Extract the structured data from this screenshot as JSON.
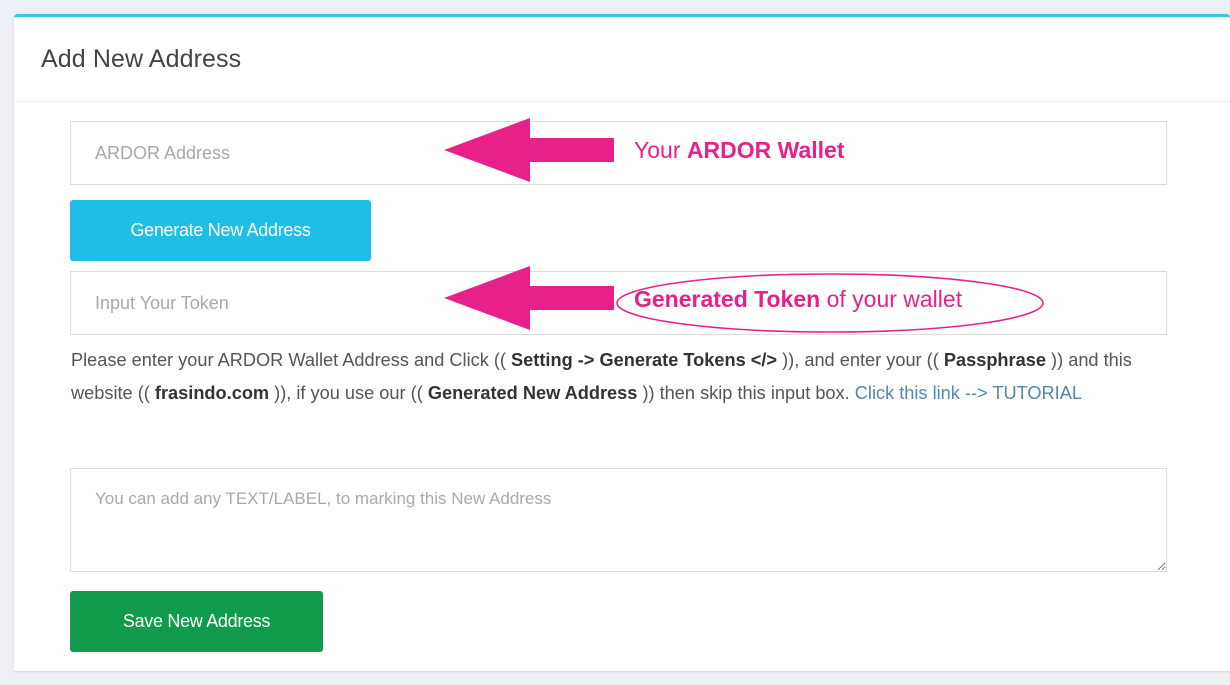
{
  "card": {
    "title": "Add New Address"
  },
  "form": {
    "address_placeholder": "ARDOR Address",
    "generate_label": "Generate New Address",
    "token_placeholder": "Input Your Token",
    "label_placeholder": "You can add any TEXT/LABEL, to marking this New Address",
    "save_label": "Save New Address"
  },
  "help": {
    "p1": "Please enter your ARDOR Wallet Address and Click ((",
    "b1": "Setting -> Generate Tokens </>",
    "p2": ")), and enter your ((",
    "b2": "Passphrase",
    "p3": ")) and this website ((",
    "b3": "frasindo.com",
    "p4": ")), if you use our ((",
    "b4": "Generated New Address",
    "p5": ")) then skip this input box.",
    "link": "Click this link --> TUTORIAL"
  },
  "annotations": {
    "wallet_prefix": "Your",
    "wallet_bold": "ARDOR Wallet",
    "token_bold": "Generated Token",
    "token_suffix": "of your wallet"
  },
  "colors": {
    "accent": "#39c3e6",
    "primary_button": "#1fbee7",
    "success_button": "#129b4c",
    "annotation": "#e8218a",
    "link": "#4f88b3"
  }
}
